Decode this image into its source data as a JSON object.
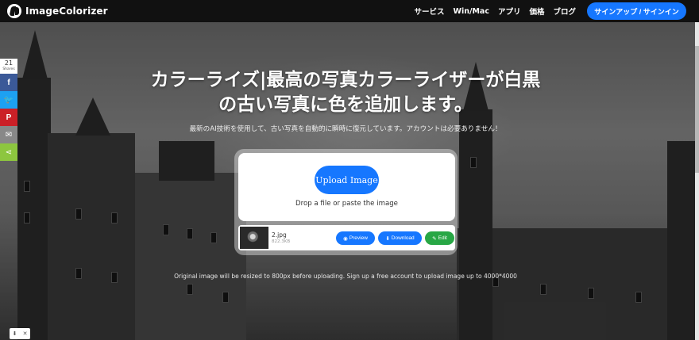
{
  "header": {
    "logo_text": "ImageColorizer",
    "nav": [
      "サービス",
      "Win/Mac",
      "アプリ",
      "価格",
      "ブログ"
    ],
    "signup_label": "サインアップ / サインイン"
  },
  "hero": {
    "title_line1": "カラーライズ|最高の写真カラーライザーが白黒",
    "title_line2": "の古い写真に色を追加します。",
    "subtitle": "最新のAI技術を使用して、古い写真を自動的に瞬時に復元しています。アカウントは必要ありません！",
    "note": "Original image will be resized to 800px before uploading. Sign up a free account to upload image up to 4000*4000"
  },
  "upload": {
    "button_label": "Upload Image",
    "drop_text": "Drop a file or paste the image"
  },
  "file": {
    "name": "2.jpg",
    "size": "822.3KB",
    "preview_label": "Preview",
    "download_label": "Download",
    "edit_label": "Edit"
  },
  "share": {
    "count": "21",
    "label": "Shares"
  },
  "colors": {
    "accent": "#1677ff",
    "edit": "#28a745",
    "facebook": "#3b5998",
    "twitter": "#1da1f2",
    "pinterest": "#cb2027",
    "email": "#888888",
    "sharethis": "#8dc63f"
  },
  "icons": [
    "eye-icon",
    "download-icon",
    "edit-icon",
    "facebook-icon",
    "twitter-icon",
    "pinterest-icon",
    "email-icon",
    "share-icon",
    "close-icon"
  ]
}
